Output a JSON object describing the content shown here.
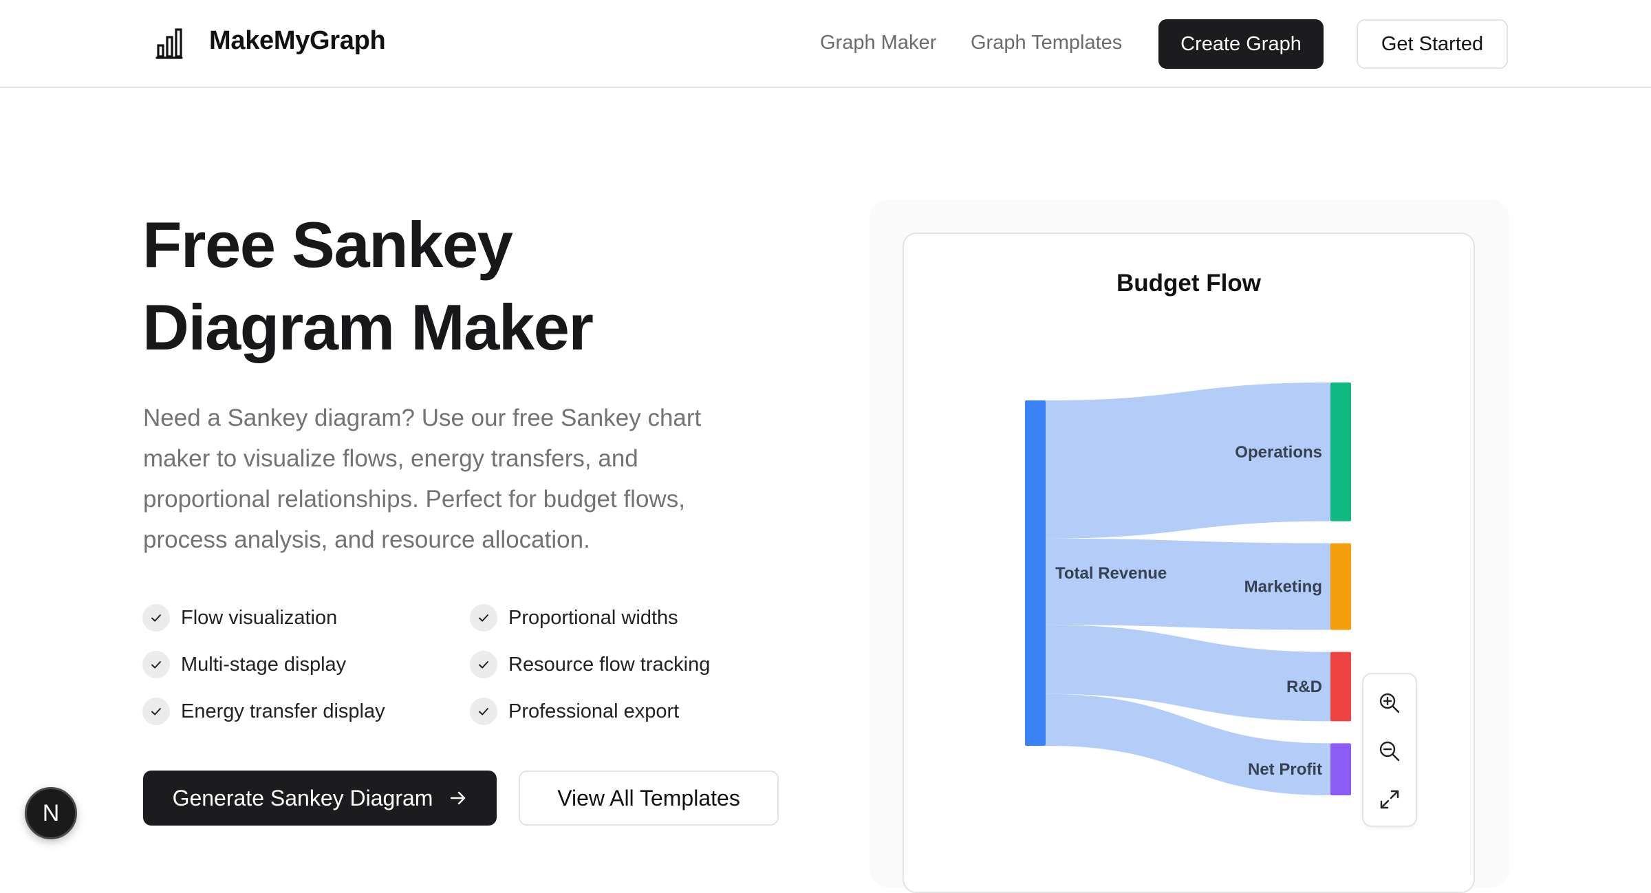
{
  "header": {
    "brand": "MakeMyGraph",
    "nav": [
      "Graph Maker",
      "Graph Templates"
    ],
    "create_button": "Create Graph",
    "started_button": "Get Started"
  },
  "hero": {
    "title_line1": "Free Sankey",
    "title_line2": "Diagram Maker",
    "description": "Need a Sankey diagram? Use our free Sankey chart maker to visualize flows, energy transfers, and proportional relationships. Perfect for budget flows, process analysis, and resource allocation.",
    "features": [
      "Flow visualization",
      "Proportional widths",
      "Multi-stage display",
      "Resource flow tracking",
      "Energy transfer display",
      "Professional export"
    ],
    "generate_button": "Generate Sankey Diagram",
    "view_button": "View All Templates"
  },
  "icons": {
    "logo": "bar-chart-icon",
    "check": "check-icon",
    "arrow": "arrow-right-icon",
    "zoom_in": "zoom-in-icon",
    "zoom_out": "zoom-out-icon",
    "fullscreen": "expand-icon",
    "badge": "next-logo-icon"
  },
  "badge": {
    "letter": "N"
  },
  "chart_data": {
    "type": "sankey",
    "title": "Budget Flow",
    "source": {
      "name": "Total Revenue",
      "color": "#3b82f6"
    },
    "targets": [
      {
        "name": "Operations",
        "value": 40,
        "color": "#10b981"
      },
      {
        "name": "Marketing",
        "value": 25,
        "color": "#f59e0b"
      },
      {
        "name": "R&D",
        "value": 20,
        "color": "#ef4444"
      },
      {
        "name": "Net Profit",
        "value": 15,
        "color": "#8b5cf6"
      }
    ],
    "link_color": "#b3cdf8"
  }
}
